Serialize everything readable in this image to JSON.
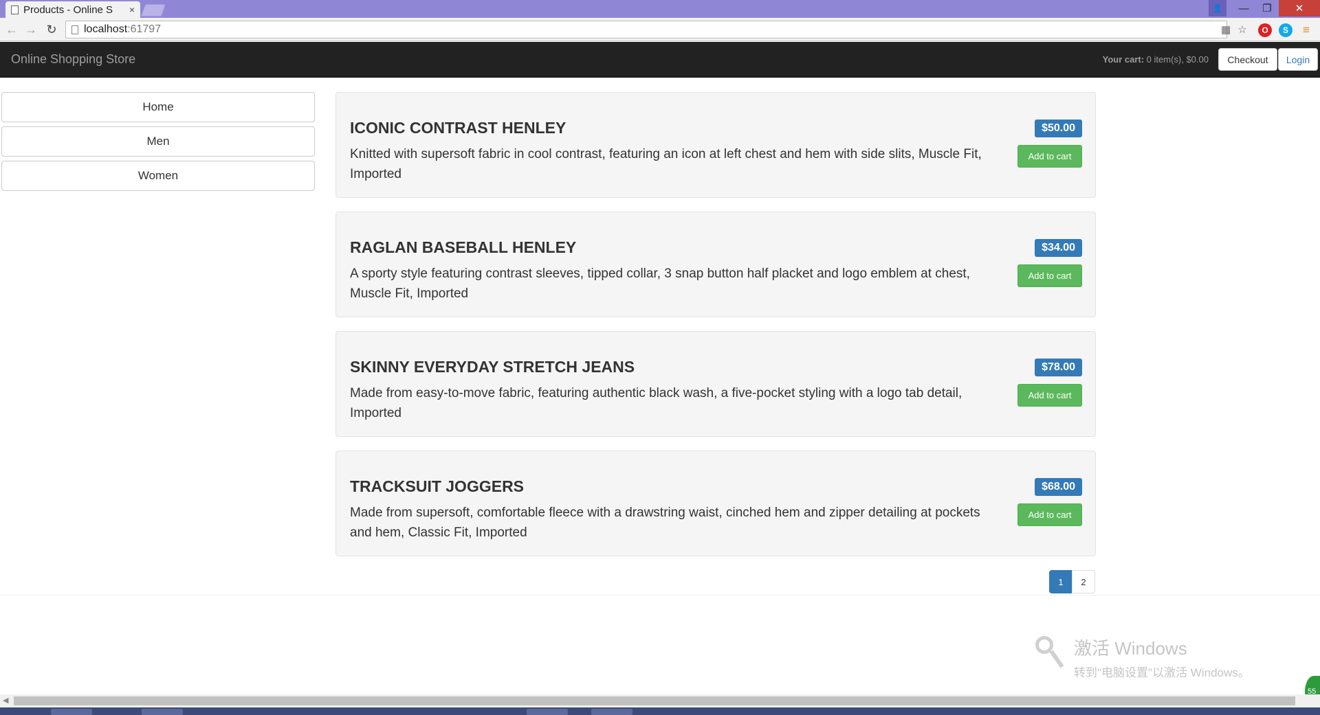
{
  "browser": {
    "tab_title": "Products - Online S",
    "tab_close": "×",
    "url_host": "localhost",
    "url_port": ":61797",
    "window_controls": {
      "user": "👤",
      "minimize": "—",
      "maximize": "❐",
      "close": "✕"
    }
  },
  "navbar": {
    "brand": "Online Shopping Store",
    "cart_label": "Your cart:",
    "cart_value": "0 item(s), $0.00",
    "checkout_label": "Checkout",
    "login_label": "Login"
  },
  "sidebar": {
    "items": [
      {
        "label": "Home"
      },
      {
        "label": "Men"
      },
      {
        "label": "Women"
      }
    ]
  },
  "products": [
    {
      "name": "ICONIC CONTRAST HENLEY",
      "description": "Knitted with supersoft fabric in cool contrast, featuring an icon at left chest and hem with side slits, Muscle Fit, Imported",
      "price": "$50.00",
      "button": "Add to cart"
    },
    {
      "name": "RAGLAN BASEBALL HENLEY",
      "description": "A sporty style featuring contrast sleeves, tipped collar, 3 snap button half placket and logo emblem at chest, Muscle Fit, Imported",
      "price": "$34.00",
      "button": "Add to cart"
    },
    {
      "name": "SKINNY EVERYDAY STRETCH JEANS",
      "description": "Made from easy-to-move fabric, featuring authentic black wash, a five-pocket styling with a logo tab detail, Imported",
      "price": "$78.00",
      "button": "Add to cart"
    },
    {
      "name": "TRACKSUIT JOGGERS",
      "description": "Made from supersoft, comfortable fleece with a drawstring waist, cinched hem and zipper detailing at pockets and hem, Classic Fit, Imported",
      "price": "$68.00",
      "button": "Add to cart"
    }
  ],
  "pagination": {
    "pages": [
      "1",
      "2"
    ],
    "current": "1"
  },
  "watermark": {
    "line1": "激活 Windows",
    "line2": "转到\"电脑设置\"以激活 Windows。"
  },
  "tray": {
    "badge": "55"
  },
  "colors": {
    "navbar_bg": "#222222",
    "primary": "#337ab7",
    "success": "#5cb85c",
    "titlebar": "#8f87d6"
  }
}
